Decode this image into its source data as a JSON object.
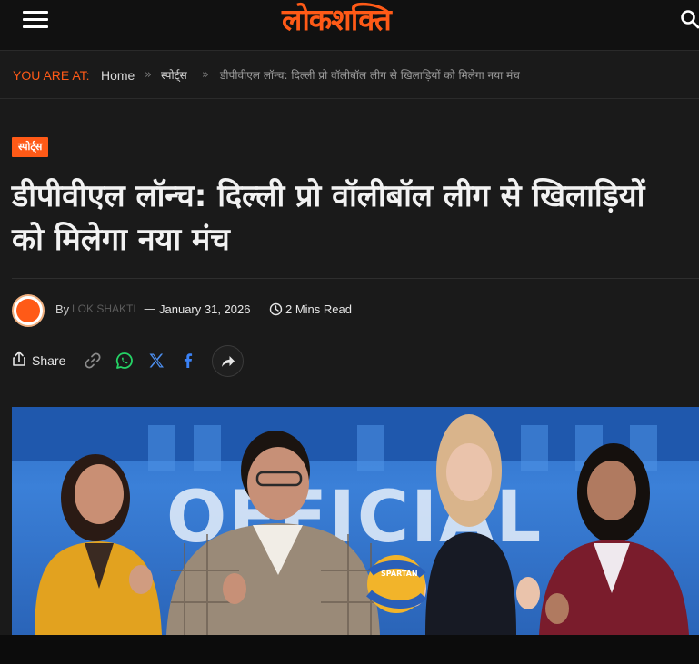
{
  "header": {
    "menu_icon": "hamburger-icon",
    "logo_text": "लोकशक्ति",
    "search_icon": "search-icon",
    "accent_color": "#ff5a17"
  },
  "breadcrumb": {
    "label": "YOU ARE AT:",
    "home": "Home",
    "separator": "»",
    "category": "स्पोर्ट्स",
    "current": "डीपीवीएल लॉन्च: दिल्ली प्रो वॉलीबॉल लीग से खिलाड़ियों को मिलेगा नया मंच"
  },
  "article": {
    "category_badge": "स्पोर्ट्स",
    "title": "डीपीवीएल लॉन्च: दिल्ली प्रो वॉलीबॉल लीग से खिलाड़ियों को मिलेगा नया मंच",
    "meta": {
      "by": "By",
      "author": "LOK SHAKTI",
      "dash": "—",
      "date": "January 31, 2026",
      "read_time": "2 Mins Read"
    },
    "share": {
      "label": "Share",
      "icons": [
        "share-icon",
        "link-icon",
        "whatsapp-icon",
        "x-icon",
        "facebook-icon",
        "forward-icon"
      ]
    },
    "hero_image": {
      "ball_text": "SPARTAN"
    }
  }
}
